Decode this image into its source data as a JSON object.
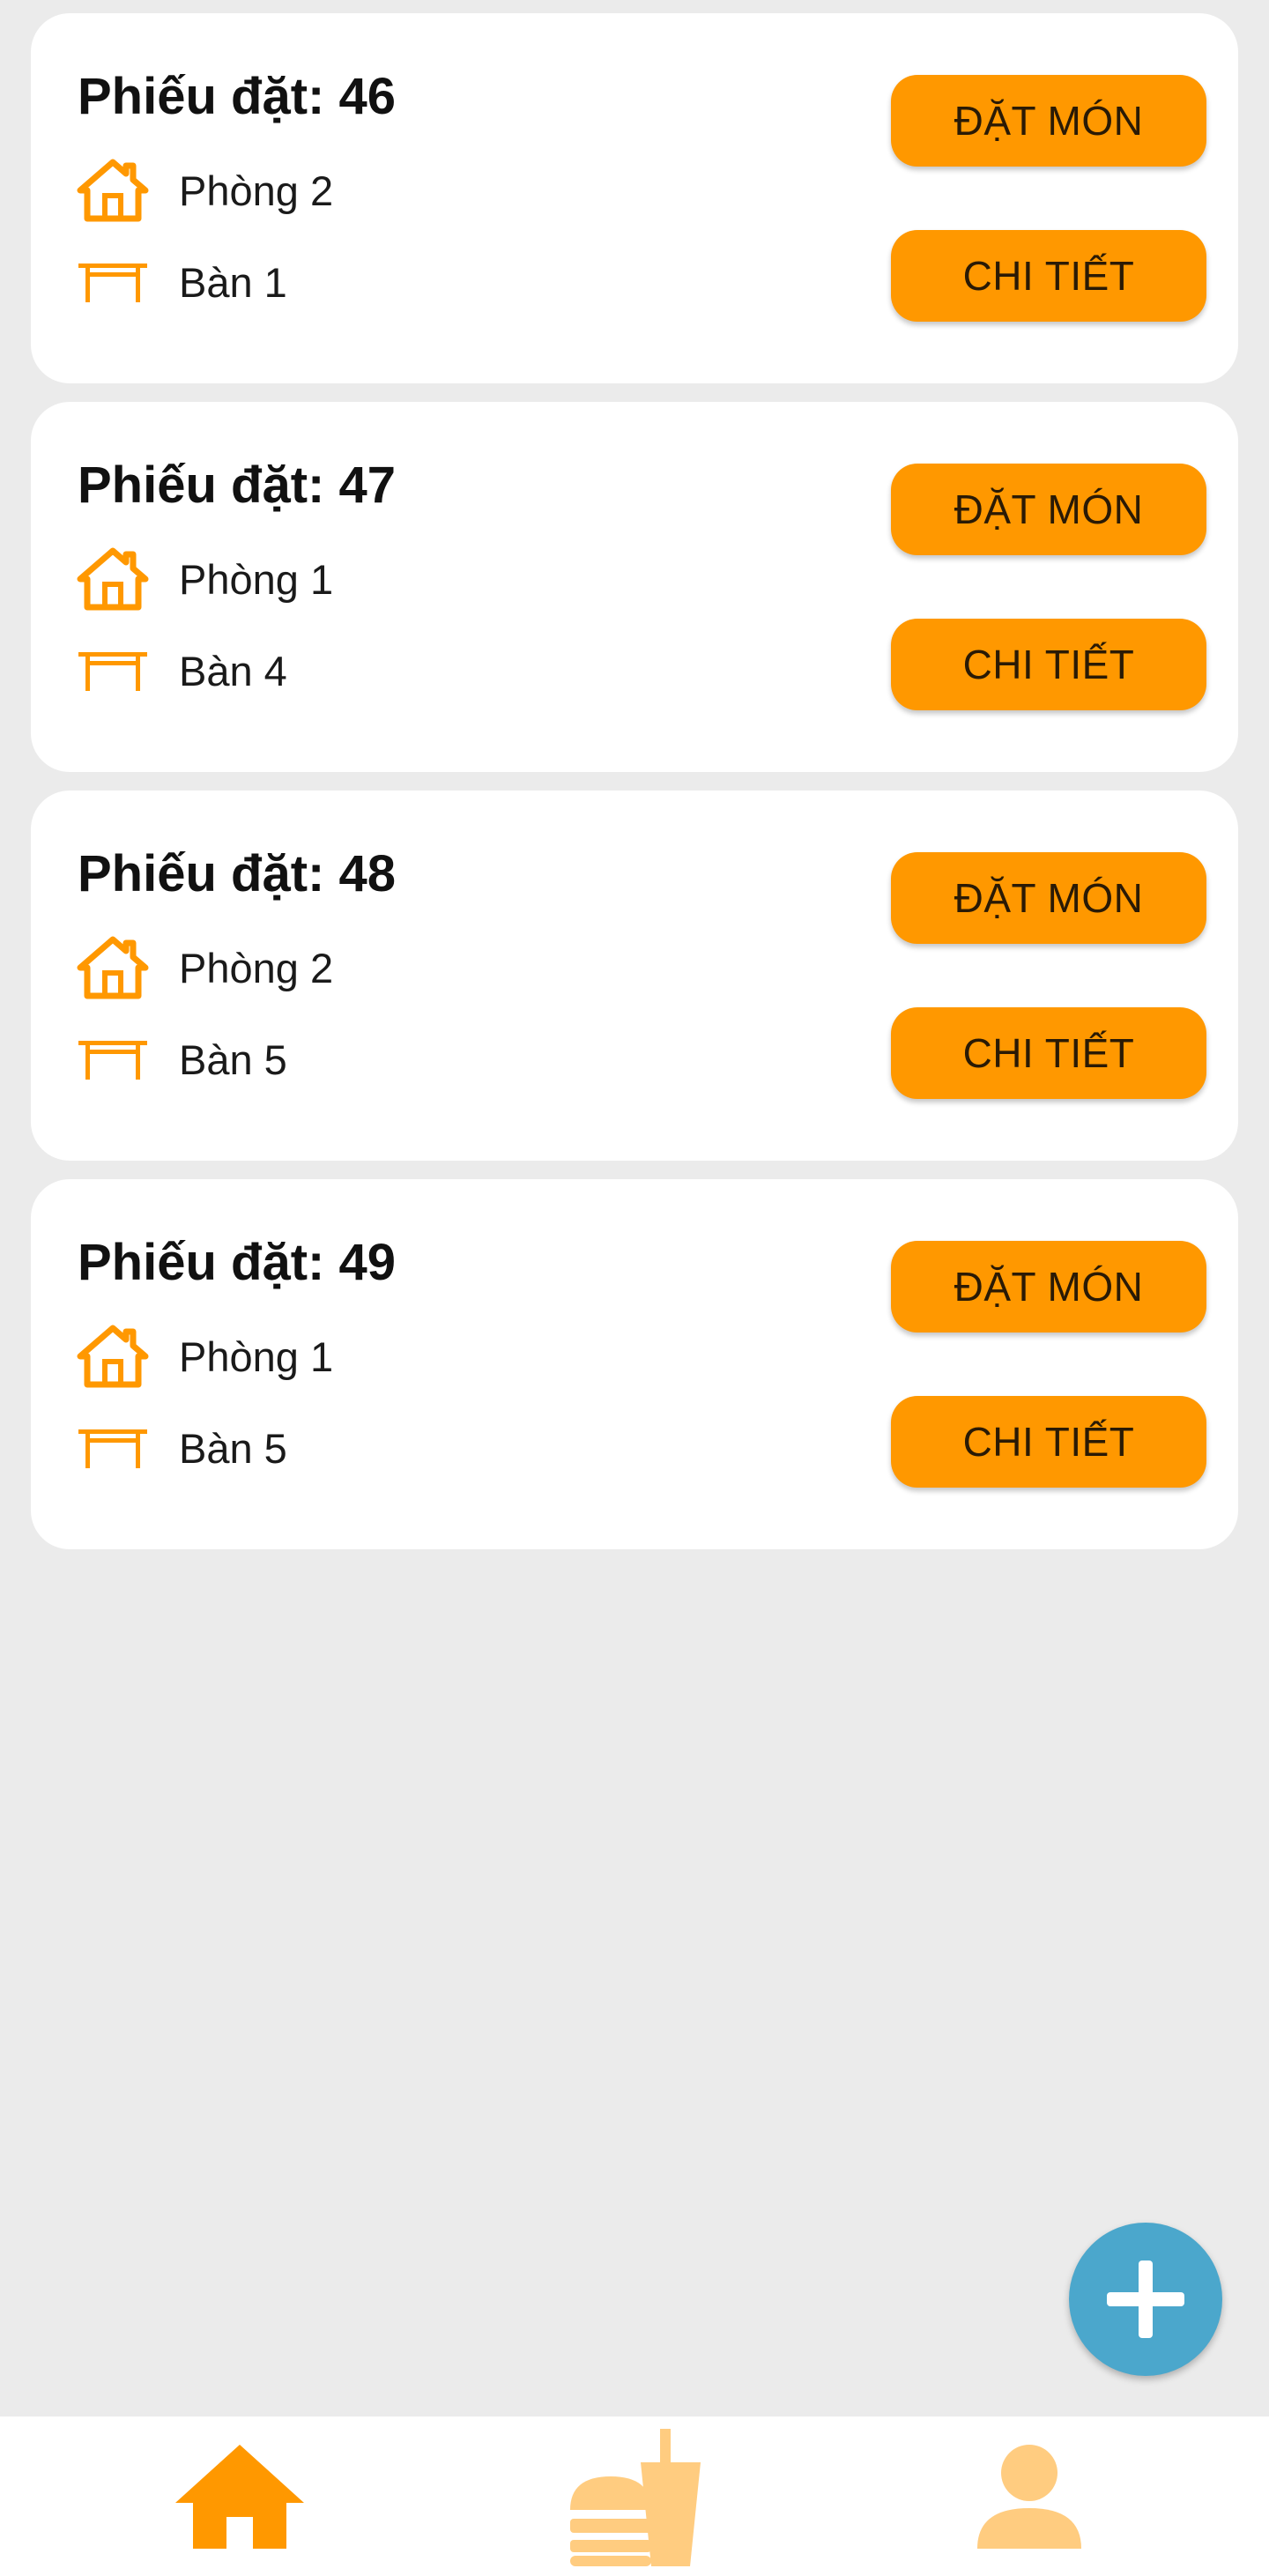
{
  "colors": {
    "accent": "#ff9800",
    "accent_light": "#ffcc80",
    "fab": "#4ba7cc",
    "background": "#ebebeb",
    "card": "#ffffff"
  },
  "bookings": [
    {
      "title": "Phiếu đặt: 46",
      "room": "Phòng 2",
      "table": "Bàn 1",
      "order_label": "ĐẶT MÓN",
      "detail_label": "CHI TIẾT"
    },
    {
      "title": "Phiếu đặt: 47",
      "room": "Phòng 1",
      "table": "Bàn 4",
      "order_label": "ĐẶT MÓN",
      "detail_label": "CHI TIẾT"
    },
    {
      "title": "Phiếu đặt: 48",
      "room": "Phòng 2",
      "table": "Bàn 5",
      "order_label": "ĐẶT MÓN",
      "detail_label": "CHI TIẾT"
    },
    {
      "title": "Phiếu đặt: 49",
      "room": "Phòng 1",
      "table": "Bàn 5",
      "order_label": "ĐẶT MÓN",
      "detail_label": "CHI TIẾT"
    }
  ],
  "icons": {
    "room": "house-icon",
    "table": "table-icon",
    "fab": "plus-icon",
    "nav_home": "home-icon",
    "nav_food": "burger-drink-icon",
    "nav_profile": "person-icon"
  },
  "bottom_nav": {
    "active": "home"
  }
}
